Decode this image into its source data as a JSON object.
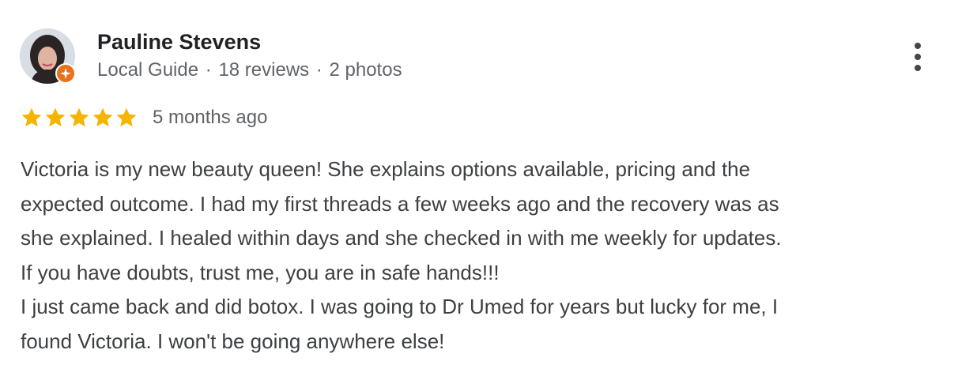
{
  "review": {
    "author": {
      "name": "Pauline Stevens",
      "badge": "Local Guide",
      "reviews": "18 reviews",
      "photos": "2 photos",
      "separator": "·",
      "avatar_icon": "profile-photo",
      "badge_icon": "local-guide-star-icon"
    },
    "more_icon": "more-vert-icon",
    "rating": 5,
    "max_rating": 5,
    "date": "5 months ago",
    "text_lines": [
      "Victoria is my new beauty queen! She explains options available, pricing and the",
      "expected outcome. I had my first threads a few weeks ago and the recovery was as",
      "she explained. I healed within days and she checked in with me weekly for updates.",
      "If you have doubts, trust me, you are in safe hands!!!",
      "I just came back and did botox. I was going to Dr Umed for years but lucky for me, I",
      "found Victoria. I won't be going anywhere else!"
    ],
    "colors": {
      "star": "#f4b400",
      "name": "#202124",
      "meta": "#5f6368",
      "text": "#3c4043",
      "badge": "#e8711a"
    }
  }
}
